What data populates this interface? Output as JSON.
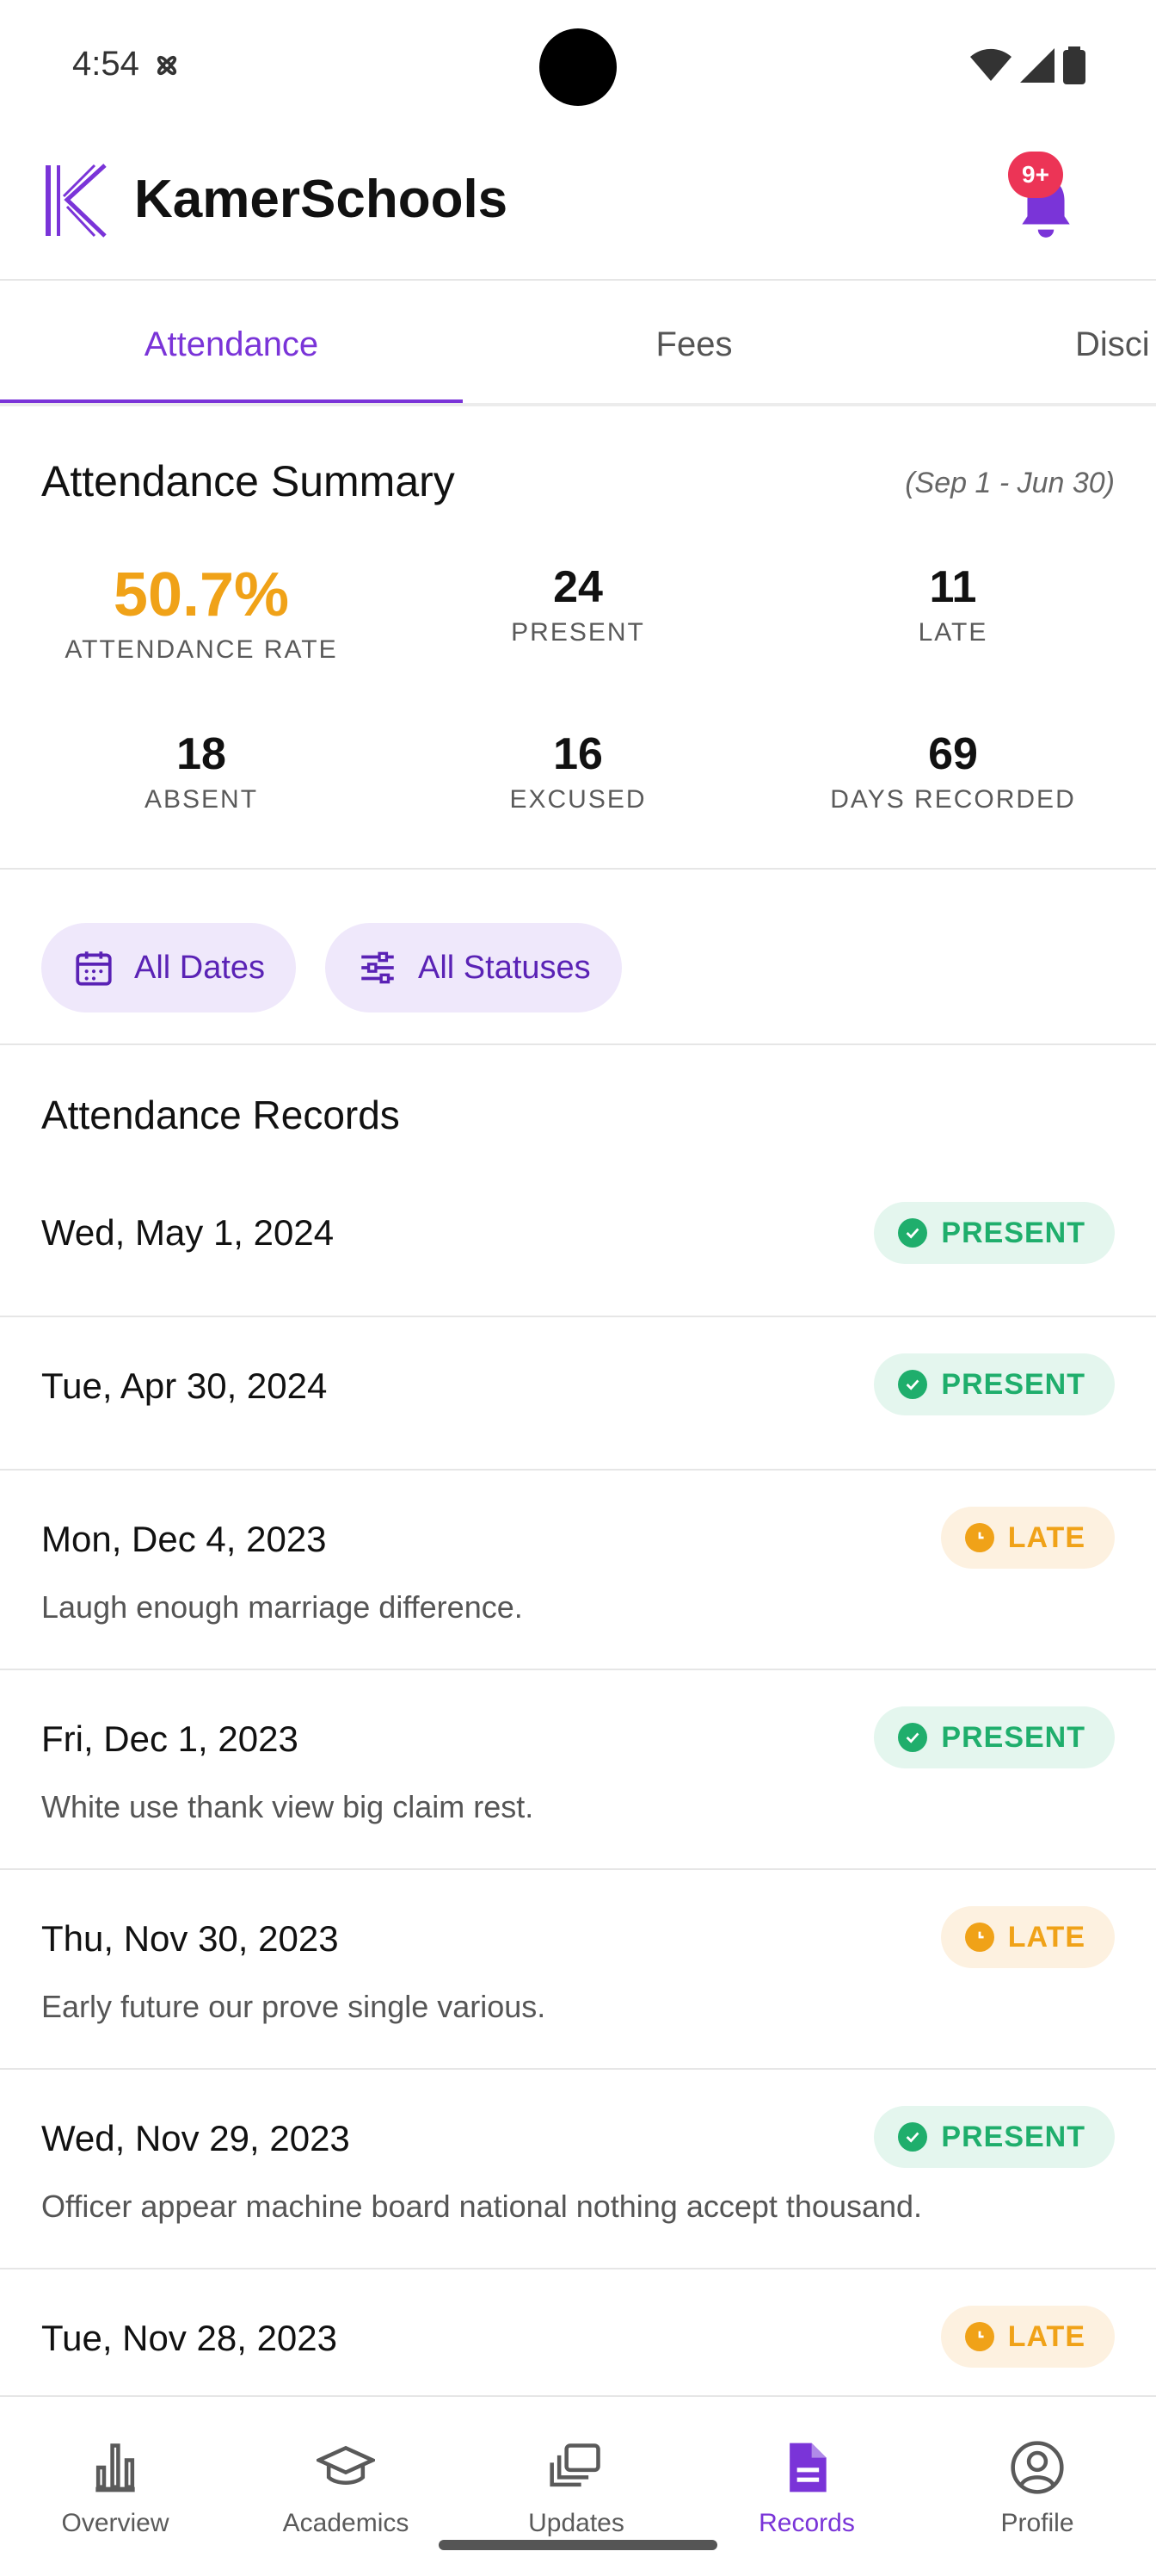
{
  "status_bar": {
    "time": "4:54"
  },
  "header": {
    "title": "KamerSchools",
    "notification_badge": "9+"
  },
  "tabs": [
    {
      "label": "Attendance",
      "active": true
    },
    {
      "label": "Fees",
      "active": false
    },
    {
      "label": "Disci",
      "active": false
    }
  ],
  "summary": {
    "title": "Attendance Summary",
    "range": "(Sep 1 - Jun 30)",
    "rate": {
      "value": "50.7%",
      "label": "ATTENDANCE RATE"
    },
    "present": {
      "value": "24",
      "label": "PRESENT"
    },
    "late": {
      "value": "11",
      "label": "LATE"
    },
    "absent": {
      "value": "18",
      "label": "ABSENT"
    },
    "excused": {
      "value": "16",
      "label": "EXCUSED"
    },
    "days": {
      "value": "69",
      "label": "DAYS RECORDED"
    }
  },
  "filters": {
    "dates": "All Dates",
    "statuses": "All Statuses"
  },
  "records": {
    "title": "Attendance Records",
    "items": [
      {
        "date": "Wed, May 1, 2024",
        "status": "PRESENT",
        "note": ""
      },
      {
        "date": "Tue, Apr 30, 2024",
        "status": "PRESENT",
        "note": ""
      },
      {
        "date": "Mon, Dec 4, 2023",
        "status": "LATE",
        "note": "Laugh enough marriage difference."
      },
      {
        "date": "Fri, Dec 1, 2023",
        "status": "PRESENT",
        "note": "White use thank view big claim rest."
      },
      {
        "date": "Thu, Nov 30, 2023",
        "status": "LATE",
        "note": "Early future our prove single various."
      },
      {
        "date": "Wed, Nov 29, 2023",
        "status": "PRESENT",
        "note": "Officer appear machine board national nothing accept thousand."
      },
      {
        "date": "Tue, Nov 28, 2023",
        "status": "LATE",
        "note": ""
      }
    ]
  },
  "bottom_nav": [
    {
      "label": "Overview",
      "icon": "bar-chart-icon",
      "active": false
    },
    {
      "label": "Academics",
      "icon": "graduation-cap-icon",
      "active": false
    },
    {
      "label": "Updates",
      "icon": "stacked-cards-icon",
      "active": false
    },
    {
      "label": "Records",
      "icon": "document-icon",
      "active": true
    },
    {
      "label": "Profile",
      "icon": "user-circle-icon",
      "active": false
    }
  ],
  "colors": {
    "brand": "#7a34d8",
    "rate_accent": "#f0a218",
    "present": "#1fae6c",
    "late": "#f0a218",
    "badge": "#ec3456"
  }
}
